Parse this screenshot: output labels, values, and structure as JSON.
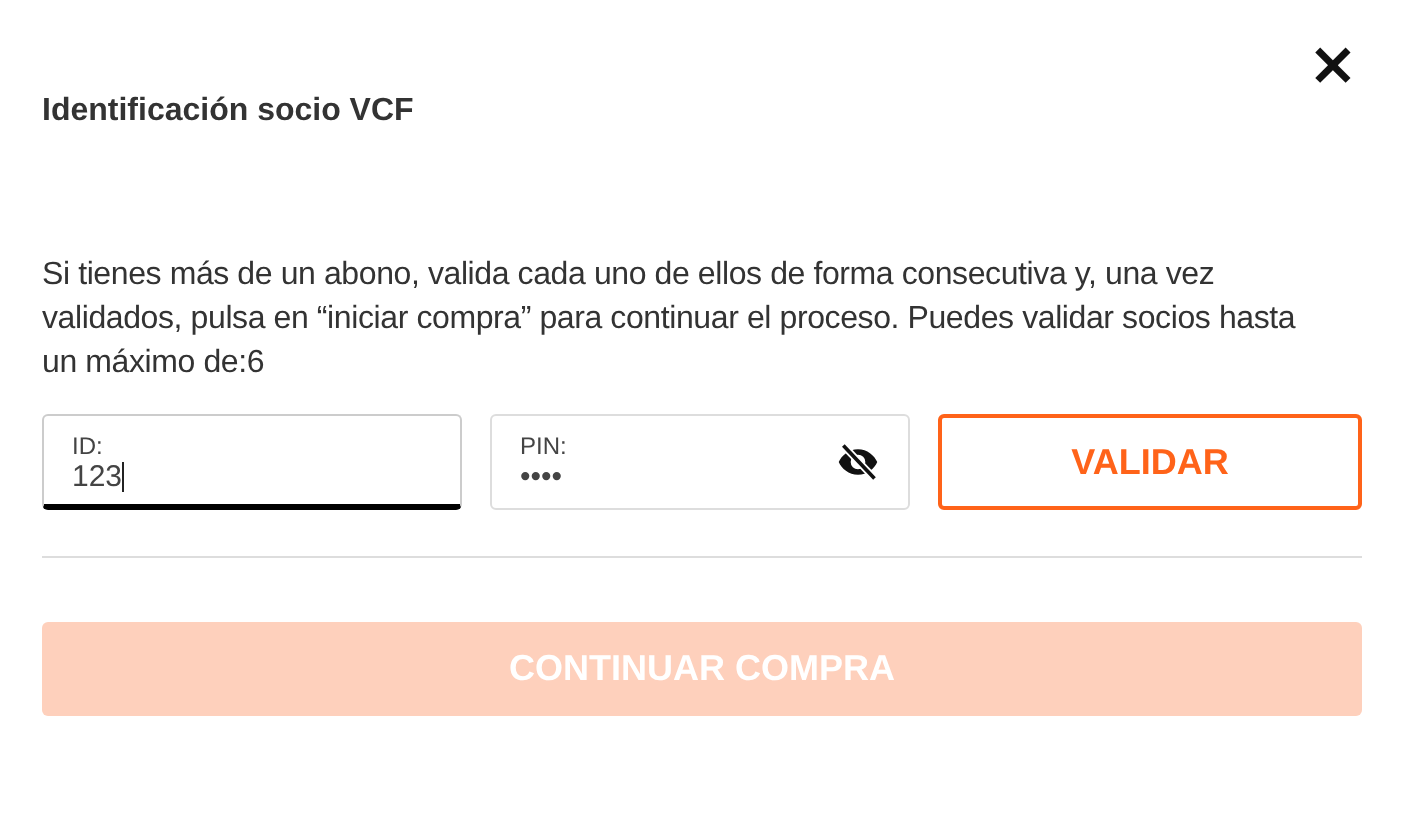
{
  "dialog": {
    "title": "Identificación socio VCF",
    "close": "×",
    "message": "Si tienes más de un abono, valida cada uno de ellos de forma consecutiva y, una vez validados, pulsa en “iniciar compra” para continuar el proceso. Puedes validar socios hasta un máximo de:6"
  },
  "fields": [
    {
      "label": "ID:",
      "value": "123",
      "focused": true,
      "masked": false
    },
    {
      "label": "PIN:",
      "value": "••••",
      "focused": false,
      "masked": true
    }
  ],
  "validate_button": {
    "label": "VALIDAR"
  },
  "continue_button": {
    "label": "CONTINUAR COMPRA",
    "disabled": true
  }
}
